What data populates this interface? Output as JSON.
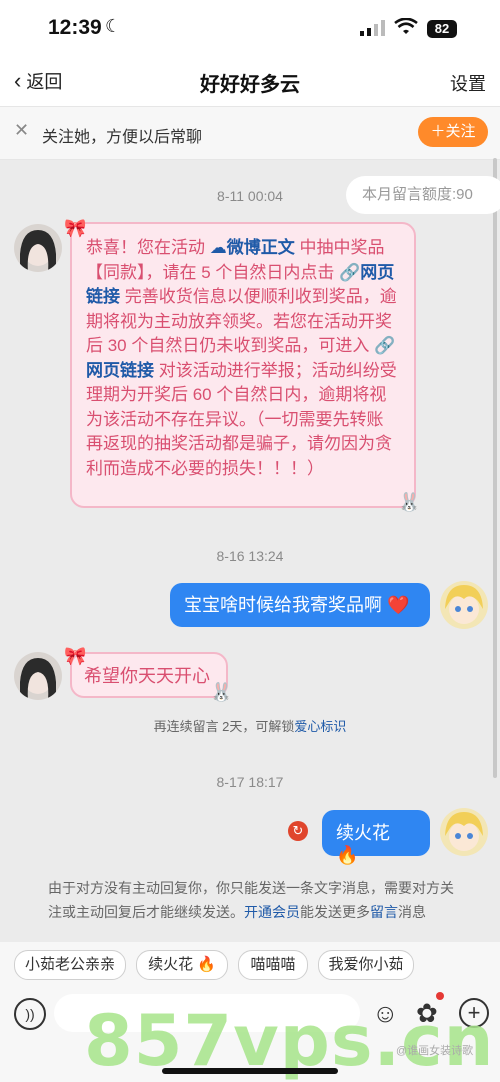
{
  "status": {
    "time": "12:39",
    "battery": "82"
  },
  "nav": {
    "back_label": "返回",
    "title": "好好好多云",
    "settings_label": "设置"
  },
  "follow": {
    "text": "关注她，方便以后常聊",
    "button": "＋关注"
  },
  "quota": "本月留言额度:90",
  "chat": {
    "ts1": "8-11 00:04",
    "msg1": {
      "p1": "恭喜！您在活动",
      "link1": "微博正文",
      "p2": " 中抽中奖品【同款】，请在 5 个自然日内点击 ",
      "link2": "网页链接",
      "p3": " 完善收货信息以便顺利收到奖品，逾期将视为主动放弃领奖。若您在活动开奖后 30 个自然日仍未收到奖品，可进入 ",
      "link3": "网页链接",
      "p4": " 对该活动进行举报；活动纠纷受理期为开奖后 60 个自然日内，逾期将视为该活动不存在异议。（一切需要先转账再返现的抽奖活动都是骗子，请勿因为贪利而造成不必要的损失！！！）"
    },
    "ts2": "8-16 13:24",
    "msg2": "宝宝啥时候给我寄奖品啊 ❤️",
    "msg3": "希望你天天开心",
    "hint": {
      "text": "再连续留言 2天，可解锁",
      "link": "爱心标识"
    },
    "ts3": "8-17 18:17",
    "msg4": "续火花 🔥",
    "notice": {
      "text": "由于对方没有主动回复你，你只能发送一条文字消息，需要对方关注或主动回复后才能继续发送。",
      "link1": "开通会员",
      "mid": "能发送更多",
      "link2": "留言",
      "end": "消息"
    }
  },
  "chips": [
    "小茹老公亲亲",
    "续火花 🔥",
    "喵喵喵",
    "我爱你小茹"
  ],
  "watermark": "857vps.cn",
  "watermark_small": "@谁画女装诗歌"
}
